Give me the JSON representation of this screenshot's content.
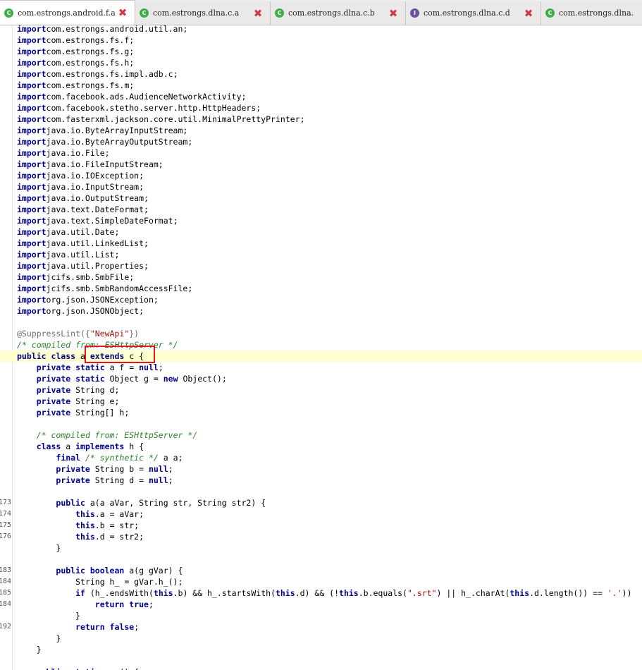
{
  "tabs": [
    {
      "label": "com.estrongs.android.f.a",
      "icon": "class-icon",
      "active": true
    },
    {
      "label": "com.estrongs.dlna.c.a",
      "icon": "class-icon",
      "active": false
    },
    {
      "label": "com.estrongs.dlna.c.b",
      "icon": "class-icon",
      "active": false
    },
    {
      "label": "com.estrongs.dlna.c.d",
      "icon": "interface-icon",
      "active": false
    },
    {
      "label": "com.estrongs.dlna.",
      "icon": "class-icon",
      "active": false
    }
  ],
  "icon_glyphs": {
    "class": "C",
    "interface": "I",
    "close": "✖"
  },
  "highlight_color": "#ffffd0",
  "annotation_box_color": "#e01818",
  "lines": [
    {
      "n": "",
      "tokens": [
        [
          "k",
          "import"
        ],
        [
          "",
          "com.estrongs.android.util.an;"
        ]
      ]
    },
    {
      "n": "",
      "tokens": [
        [
          "k",
          "import"
        ],
        [
          "",
          "com.estrongs.fs.f;"
        ]
      ]
    },
    {
      "n": "",
      "tokens": [
        [
          "k",
          "import"
        ],
        [
          "",
          "com.estrongs.fs.g;"
        ]
      ]
    },
    {
      "n": "",
      "tokens": [
        [
          "k",
          "import"
        ],
        [
          "",
          "com.estrongs.fs.h;"
        ]
      ]
    },
    {
      "n": "",
      "tokens": [
        [
          "k",
          "import"
        ],
        [
          "",
          "com.estrongs.fs.impl.adb.c;"
        ]
      ]
    },
    {
      "n": "",
      "tokens": [
        [
          "k",
          "import"
        ],
        [
          "",
          "com.estrongs.fs.m;"
        ]
      ]
    },
    {
      "n": "",
      "tokens": [
        [
          "k",
          "import"
        ],
        [
          "",
          "com.facebook.ads.AudienceNetworkActivity;"
        ]
      ]
    },
    {
      "n": "",
      "tokens": [
        [
          "k",
          "import"
        ],
        [
          "",
          "com.facebook.stetho.server.http.HttpHeaders;"
        ]
      ]
    },
    {
      "n": "",
      "tokens": [
        [
          "k",
          "import"
        ],
        [
          "",
          "com.fasterxml.jackson.core.util.MinimalPrettyPrinter;"
        ]
      ]
    },
    {
      "n": "",
      "tokens": [
        [
          "k",
          "import"
        ],
        [
          "",
          "java.io.ByteArrayInputStream;"
        ]
      ]
    },
    {
      "n": "",
      "tokens": [
        [
          "k",
          "import"
        ],
        [
          "",
          "java.io.ByteArrayOutputStream;"
        ]
      ]
    },
    {
      "n": "",
      "tokens": [
        [
          "k",
          "import"
        ],
        [
          "",
          "java.io.File;"
        ]
      ]
    },
    {
      "n": "",
      "tokens": [
        [
          "k",
          "import"
        ],
        [
          "",
          "java.io.FileInputStream;"
        ]
      ]
    },
    {
      "n": "",
      "tokens": [
        [
          "k",
          "import"
        ],
        [
          "",
          "java.io.IOException;"
        ]
      ]
    },
    {
      "n": "",
      "tokens": [
        [
          "k",
          "import"
        ],
        [
          "",
          "java.io.InputStream;"
        ]
      ]
    },
    {
      "n": "",
      "tokens": [
        [
          "k",
          "import"
        ],
        [
          "",
          "java.io.OutputStream;"
        ]
      ]
    },
    {
      "n": "",
      "tokens": [
        [
          "k",
          "import"
        ],
        [
          "",
          "java.text.DateFormat;"
        ]
      ]
    },
    {
      "n": "",
      "tokens": [
        [
          "k",
          "import"
        ],
        [
          "",
          "java.text.SimpleDateFormat;"
        ]
      ]
    },
    {
      "n": "",
      "tokens": [
        [
          "k",
          "import"
        ],
        [
          "",
          "java.util.Date;"
        ]
      ]
    },
    {
      "n": "",
      "tokens": [
        [
          "k",
          "import"
        ],
        [
          "",
          "java.util.LinkedList;"
        ]
      ]
    },
    {
      "n": "",
      "tokens": [
        [
          "k",
          "import"
        ],
        [
          "",
          "java.util.List;"
        ]
      ]
    },
    {
      "n": "",
      "tokens": [
        [
          "k",
          "import"
        ],
        [
          "",
          "java.util.Properties;"
        ]
      ]
    },
    {
      "n": "",
      "tokens": [
        [
          "k",
          "import"
        ],
        [
          "",
          "jcifs.smb.SmbFile;"
        ]
      ]
    },
    {
      "n": "",
      "tokens": [
        [
          "k",
          "import"
        ],
        [
          "",
          "jcifs.smb.SmbRandomAccessFile;"
        ]
      ]
    },
    {
      "n": "",
      "tokens": [
        [
          "k",
          "import"
        ],
        [
          "",
          "org.json.JSONException;"
        ]
      ]
    },
    {
      "n": "",
      "tokens": [
        [
          "k",
          "import"
        ],
        [
          "",
          "org.json.JSONObject;"
        ]
      ]
    },
    {
      "n": "",
      "tokens": []
    },
    {
      "n": "",
      "tokens": [
        [
          "an",
          "@SuppressLint({"
        ],
        [
          "s",
          "\"NewApi\""
        ],
        [
          "an",
          "})"
        ]
      ]
    },
    {
      "n": "",
      "tokens": [
        [
          "c",
          "/* compiled from: ESHttpServer */"
        ]
      ]
    },
    {
      "n": "",
      "hl": true,
      "tokens": [
        [
          "k",
          "public class "
        ],
        [
          "",
          "a "
        ],
        [
          "k",
          "extends "
        ],
        [
          "",
          "c {"
        ]
      ]
    },
    {
      "n": "",
      "tokens": [
        [
          "",
          "    "
        ],
        [
          "k",
          "private static "
        ],
        [
          "",
          "a f = "
        ],
        [
          "k",
          "null"
        ],
        [
          "",
          ";"
        ]
      ]
    },
    {
      "n": "",
      "tokens": [
        [
          "",
          "    "
        ],
        [
          "k",
          "private static "
        ],
        [
          "",
          "Object g = "
        ],
        [
          "k",
          "new "
        ],
        [
          "",
          "Object();"
        ]
      ]
    },
    {
      "n": "",
      "tokens": [
        [
          "",
          "    "
        ],
        [
          "k",
          "private "
        ],
        [
          "",
          "String d;"
        ]
      ]
    },
    {
      "n": "",
      "tokens": [
        [
          "",
          "    "
        ],
        [
          "k",
          "private "
        ],
        [
          "",
          "String e;"
        ]
      ]
    },
    {
      "n": "",
      "tokens": [
        [
          "",
          "    "
        ],
        [
          "k",
          "private "
        ],
        [
          "",
          "String[] h;"
        ]
      ]
    },
    {
      "n": "",
      "tokens": []
    },
    {
      "n": "",
      "tokens": [
        [
          "",
          "    "
        ],
        [
          "c",
          "/* compiled from: ESHttpServer */"
        ]
      ]
    },
    {
      "n": "",
      "tokens": [
        [
          "",
          "    "
        ],
        [
          "k",
          "class "
        ],
        [
          "",
          "a "
        ],
        [
          "k",
          "implements "
        ],
        [
          "",
          "h {"
        ]
      ]
    },
    {
      "n": "",
      "tokens": [
        [
          "",
          "        "
        ],
        [
          "k",
          "final "
        ],
        [
          "c",
          "/* synthetic */ "
        ],
        [
          "",
          "a a;"
        ]
      ]
    },
    {
      "n": "",
      "tokens": [
        [
          "",
          "        "
        ],
        [
          "k",
          "private "
        ],
        [
          "",
          "String b = "
        ],
        [
          "k",
          "null"
        ],
        [
          "",
          ";"
        ]
      ]
    },
    {
      "n": "",
      "tokens": [
        [
          "",
          "        "
        ],
        [
          "k",
          "private "
        ],
        [
          "",
          "String d = "
        ],
        [
          "k",
          "null"
        ],
        [
          "",
          ";"
        ]
      ]
    },
    {
      "n": "",
      "tokens": []
    },
    {
      "n": "173",
      "tokens": [
        [
          "",
          "        "
        ],
        [
          "k",
          "public "
        ],
        [
          "",
          "a(a aVar, String str, String str2) {"
        ]
      ]
    },
    {
      "n": "174",
      "tokens": [
        [
          "",
          "            "
        ],
        [
          "k",
          "this"
        ],
        [
          "",
          ".a = aVar;"
        ]
      ]
    },
    {
      "n": "175",
      "tokens": [
        [
          "",
          "            "
        ],
        [
          "k",
          "this"
        ],
        [
          "",
          ".b = str;"
        ]
      ]
    },
    {
      "n": "176",
      "tokens": [
        [
          "",
          "            "
        ],
        [
          "k",
          "this"
        ],
        [
          "",
          ".d = str2;"
        ]
      ]
    },
    {
      "n": "",
      "tokens": [
        [
          "",
          "        }"
        ]
      ]
    },
    {
      "n": "",
      "tokens": []
    },
    {
      "n": "183",
      "tokens": [
        [
          "",
          "        "
        ],
        [
          "k",
          "public "
        ],
        [
          "t",
          "boolean "
        ],
        [
          "",
          "a(g gVar) {"
        ]
      ]
    },
    {
      "n": "184",
      "tokens": [
        [
          "",
          "            String h_ = gVar.h_();"
        ]
      ]
    },
    {
      "n": "185",
      "tokens": [
        [
          "",
          "            "
        ],
        [
          "k",
          "if "
        ],
        [
          "",
          "(h_.endsWith("
        ],
        [
          "k",
          "this"
        ],
        [
          "",
          ".b) && h_.startsWith("
        ],
        [
          "k",
          "this"
        ],
        [
          "",
          ".d) && (!"
        ],
        [
          "k",
          "this"
        ],
        [
          "",
          ".b.equals("
        ],
        [
          "s",
          "\".srt\""
        ],
        [
          "",
          ") || h_.charAt("
        ],
        [
          "k",
          "this"
        ],
        [
          "",
          ".d.length()) == "
        ],
        [
          "s",
          "'.'"
        ],
        [
          "",
          "))"
        ]
      ]
    },
    {
      "n": "184",
      "tokens": [
        [
          "",
          "                "
        ],
        [
          "k",
          "return true"
        ],
        [
          "",
          ";"
        ]
      ]
    },
    {
      "n": "",
      "tokens": [
        [
          "",
          "            }"
        ]
      ]
    },
    {
      "n": "192",
      "tokens": [
        [
          "",
          "            "
        ],
        [
          "k",
          "return false"
        ],
        [
          "",
          ";"
        ]
      ]
    },
    {
      "n": "",
      "tokens": [
        [
          "",
          "        }"
        ]
      ]
    },
    {
      "n": "",
      "tokens": [
        [
          "",
          "    }"
        ]
      ]
    },
    {
      "n": "",
      "tokens": []
    },
    {
      "n": "",
      "tokens": [
        [
          "",
          "    "
        ],
        [
          "k",
          "public static "
        ],
        [
          "",
          "a a() {"
        ]
      ]
    }
  ]
}
